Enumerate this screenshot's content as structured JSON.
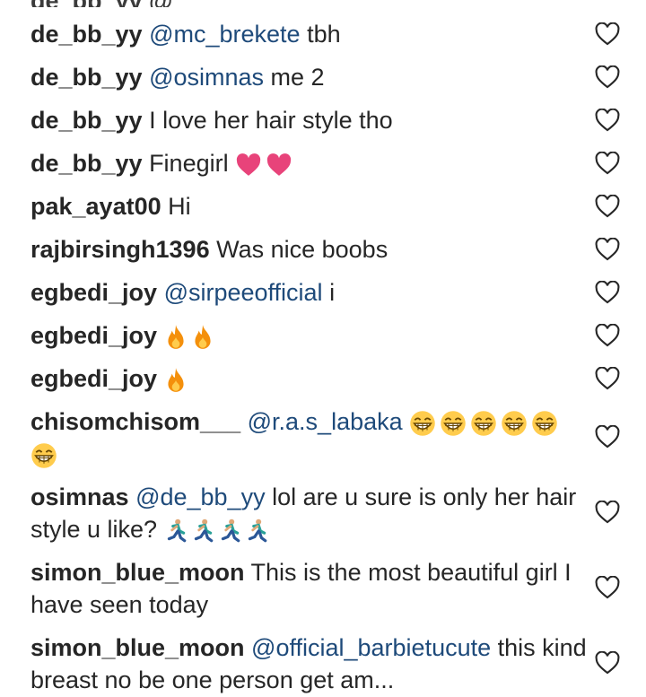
{
  "comments": [
    {
      "user": "de_bb_yy",
      "mention": "@mc_brekete",
      "text": " tbh",
      "emojis": ""
    },
    {
      "user": "de_bb_yy",
      "mention": "@osimnas",
      "text": " me 2",
      "emojis": ""
    },
    {
      "user": "de_bb_yy",
      "mention": "",
      "text": " I love her hair style tho",
      "emojis": ""
    },
    {
      "user": "de_bb_yy",
      "mention": "",
      "text": " Finegirl",
      "emojis": "heart-emoji x2"
    },
    {
      "user": "pak_ayat00",
      "mention": "",
      "text": " Hi",
      "emojis": ""
    },
    {
      "user": "rajbirsingh1396",
      "mention": "",
      "text": " Was nice boobs",
      "emojis": ""
    },
    {
      "user": "egbedi_joy",
      "mention": "@sirpeeofficial",
      "text": " i",
      "emojis": ""
    },
    {
      "user": "egbedi_joy",
      "mention": "",
      "text": "",
      "emojis": "fire-emoji x2"
    },
    {
      "user": "egbedi_joy",
      "mention": "",
      "text": "",
      "emojis": "fire-emoji x1"
    },
    {
      "user": "chisomchisom___",
      "mention": "@r.a.s_labaka",
      "text": "",
      "emojis": "grin-emoji x6"
    },
    {
      "user": "osimnas",
      "mention": "@de_bb_yy",
      "text": " lol are u sure is only her hair style u like?",
      "emojis": "runner-emoji x4"
    },
    {
      "user": "simon_blue_moon",
      "mention": "",
      "text": " This is the most beautiful girl I have seen today",
      "emojis": ""
    },
    {
      "user": "simon_blue_moon",
      "mention": "@official_barbietucute",
      "text": " this kind breast no be one person get am...",
      "emojis": ""
    }
  ],
  "icons": {
    "like": "heart-outline-icon"
  },
  "colors": {
    "mention": "#1e4a7a",
    "text": "#262626",
    "heart": "#262626"
  }
}
